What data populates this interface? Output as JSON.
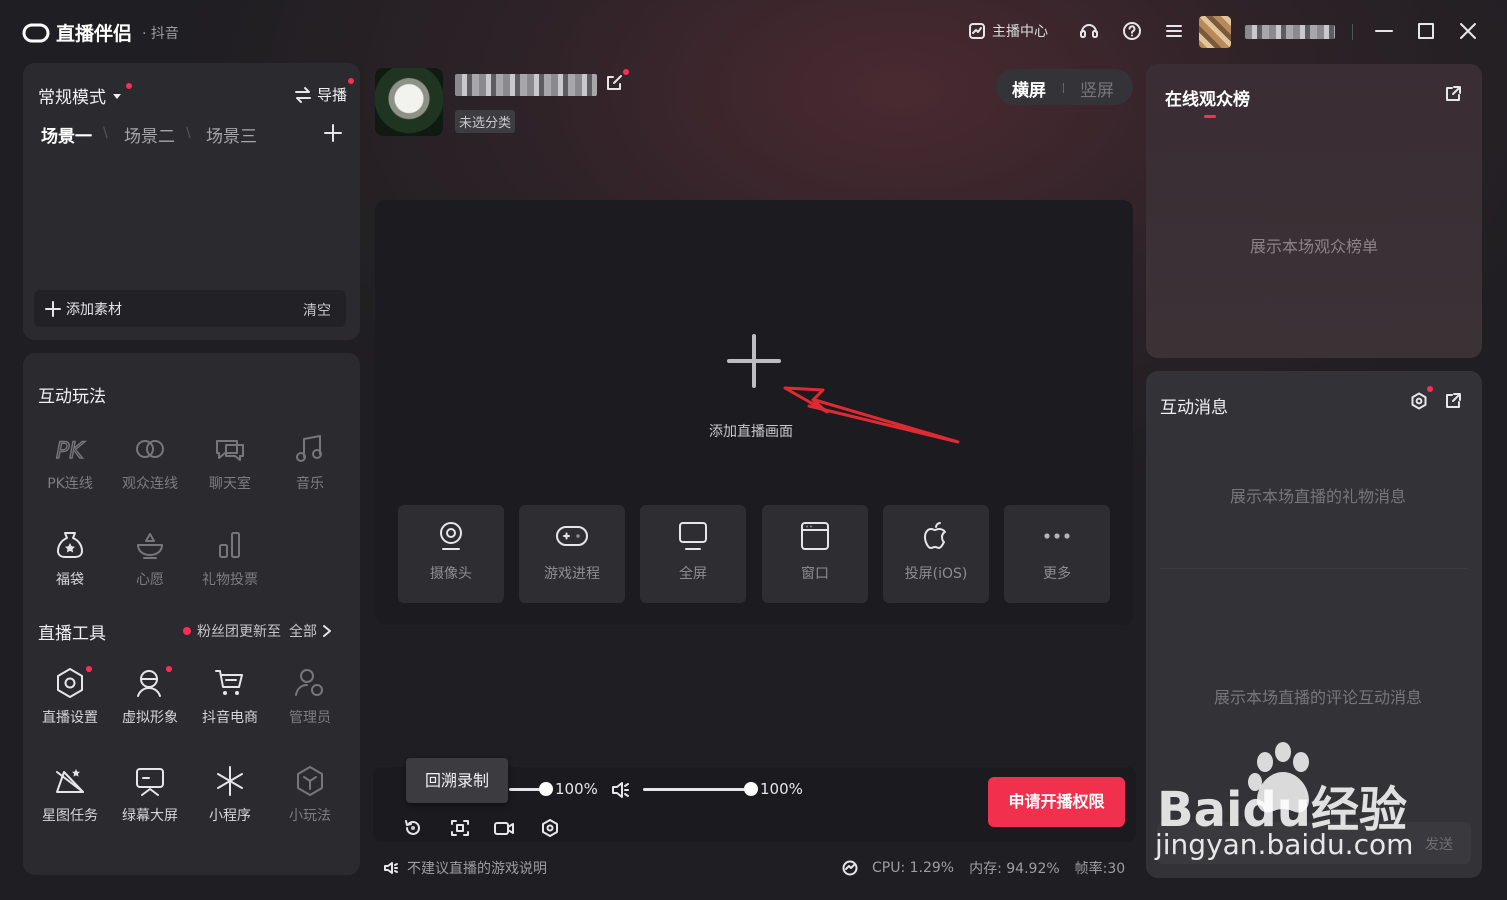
{
  "titlebar": {
    "app_name": "直播伴侣",
    "platform": "· 抖音",
    "anchor_center": "主播中心"
  },
  "scene_panel": {
    "mode": "常规模式",
    "guide": "导播",
    "scenes": [
      "场景一",
      "场景二",
      "场景三"
    ],
    "add_material": "添加素材",
    "clear": "清空"
  },
  "interact": {
    "title": "互动玩法",
    "items": [
      {
        "label": "PK连线",
        "icon": "pk-icon"
      },
      {
        "label": "观众连线",
        "icon": "link-icon"
      },
      {
        "label": "聊天室",
        "icon": "chat-room-icon"
      },
      {
        "label": "音乐",
        "icon": "music-icon"
      },
      {
        "label": "福袋",
        "icon": "lucky-bag-icon"
      },
      {
        "label": "心愿",
        "icon": "wish-icon"
      },
      {
        "label": "礼物投票",
        "icon": "vote-icon"
      }
    ]
  },
  "tools": {
    "title": "直播工具",
    "update_notice": "粉丝团更新至",
    "all": "全部",
    "items": [
      {
        "label": "直播设置",
        "icon": "settings-hex-icon"
      },
      {
        "label": "虚拟形象",
        "icon": "avatar-icon"
      },
      {
        "label": "抖音电商",
        "icon": "cart-icon"
      },
      {
        "label": "管理员",
        "icon": "admin-icon"
      },
      {
        "label": "星图任务",
        "icon": "star-map-icon"
      },
      {
        "label": "绿幕大屏",
        "icon": "green-screen-icon"
      },
      {
        "label": "小程序",
        "icon": "mini-program-icon"
      },
      {
        "label": "小玩法",
        "icon": "mini-game-icon"
      }
    ]
  },
  "header": {
    "category": "未选分类",
    "orientation": {
      "landscape": "横屏",
      "portrait": "竖屏"
    }
  },
  "canvas": {
    "add_label": "添加直播画面",
    "sources": [
      {
        "label": "摄像头",
        "icon": "camera-icon"
      },
      {
        "label": "游戏进程",
        "icon": "gamepad-icon"
      },
      {
        "label": "全屏",
        "icon": "monitor-icon"
      },
      {
        "label": "窗口",
        "icon": "window-icon"
      },
      {
        "label": "投屏(iOS)",
        "icon": "apple-icon"
      },
      {
        "label": "更多",
        "icon": "more-icon"
      }
    ]
  },
  "controls": {
    "tooltip": "回溯录制",
    "mic_volume": "100%",
    "speaker_volume": "100%",
    "apply_button": "申请开播权限"
  },
  "status": {
    "game_notice": "不建议直播的游戏说明",
    "cpu": "CPU: 1.29%",
    "memory": "内存: 94.92%",
    "fps": "帧率:30"
  },
  "audience": {
    "title": "在线观众榜",
    "placeholder": "展示本场观众榜单"
  },
  "messages": {
    "title": "互动消息",
    "gift_placeholder": "展示本场直播的礼物消息",
    "comment_placeholder": "展示本场直播的评论互动消息",
    "send": "发送"
  },
  "watermark": {
    "brand": "Baidu经验",
    "url": "jingyan.baidu.com"
  },
  "colors": {
    "accent_red": "#ff2d55",
    "apply_button": "#f0304c",
    "panel": "#2b2a2e"
  }
}
